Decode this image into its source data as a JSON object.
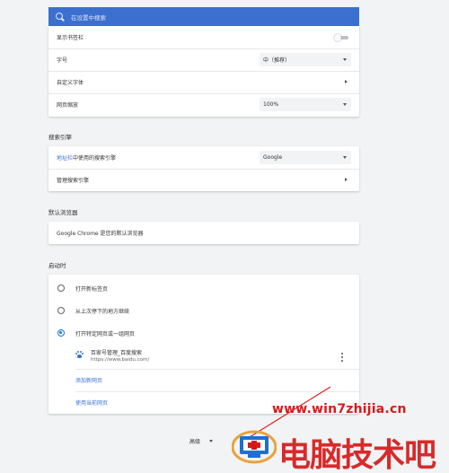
{
  "search": {
    "placeholder": "在设置中搜索"
  },
  "appearance": {
    "show_bookmarks_bar": {
      "label": "显示书签栏",
      "enabled": false
    },
    "font_size": {
      "label": "字号",
      "value": "中（推荐）"
    },
    "custom_fonts": {
      "label": "自定义字体"
    },
    "page_zoom": {
      "label": "网页缩放",
      "value": "100%"
    }
  },
  "search_engine": {
    "title": "搜索引擎",
    "address_bar": {
      "label_link": "地址栏",
      "label_rest": "中使用的搜索引擎",
      "value": "Google"
    },
    "manage": {
      "label": "管理搜索引擎"
    }
  },
  "default_browser": {
    "title": "默认浏览器",
    "text": "Google Chrome 是您的默认浏览器"
  },
  "on_startup": {
    "title": "启动时",
    "options": [
      {
        "label": "打开新标签页",
        "checked": false
      },
      {
        "label": "从上次停下的地方继续",
        "checked": false
      },
      {
        "label": "打开特定网页或一组网页",
        "checked": true
      }
    ],
    "pages": [
      {
        "title": "百家号管理_百度搜索",
        "url": "https://www.baidu.com/",
        "icon": "baidu-paw-icon"
      }
    ],
    "add_page": "添加新网页",
    "use_current": "使用当前网页"
  },
  "advanced": {
    "label": "高级"
  },
  "watermark": {
    "url": "www.win7zhijia.cn",
    "text": "电脑技术吧",
    "colors": {
      "red": "#d61a1a",
      "blue": "#1e6fd0"
    }
  },
  "colors": {
    "header": "#3b6fd0",
    "link": "#3b73d4",
    "radio_checked": "#1a73e8",
    "background": "#f1f3f4"
  }
}
